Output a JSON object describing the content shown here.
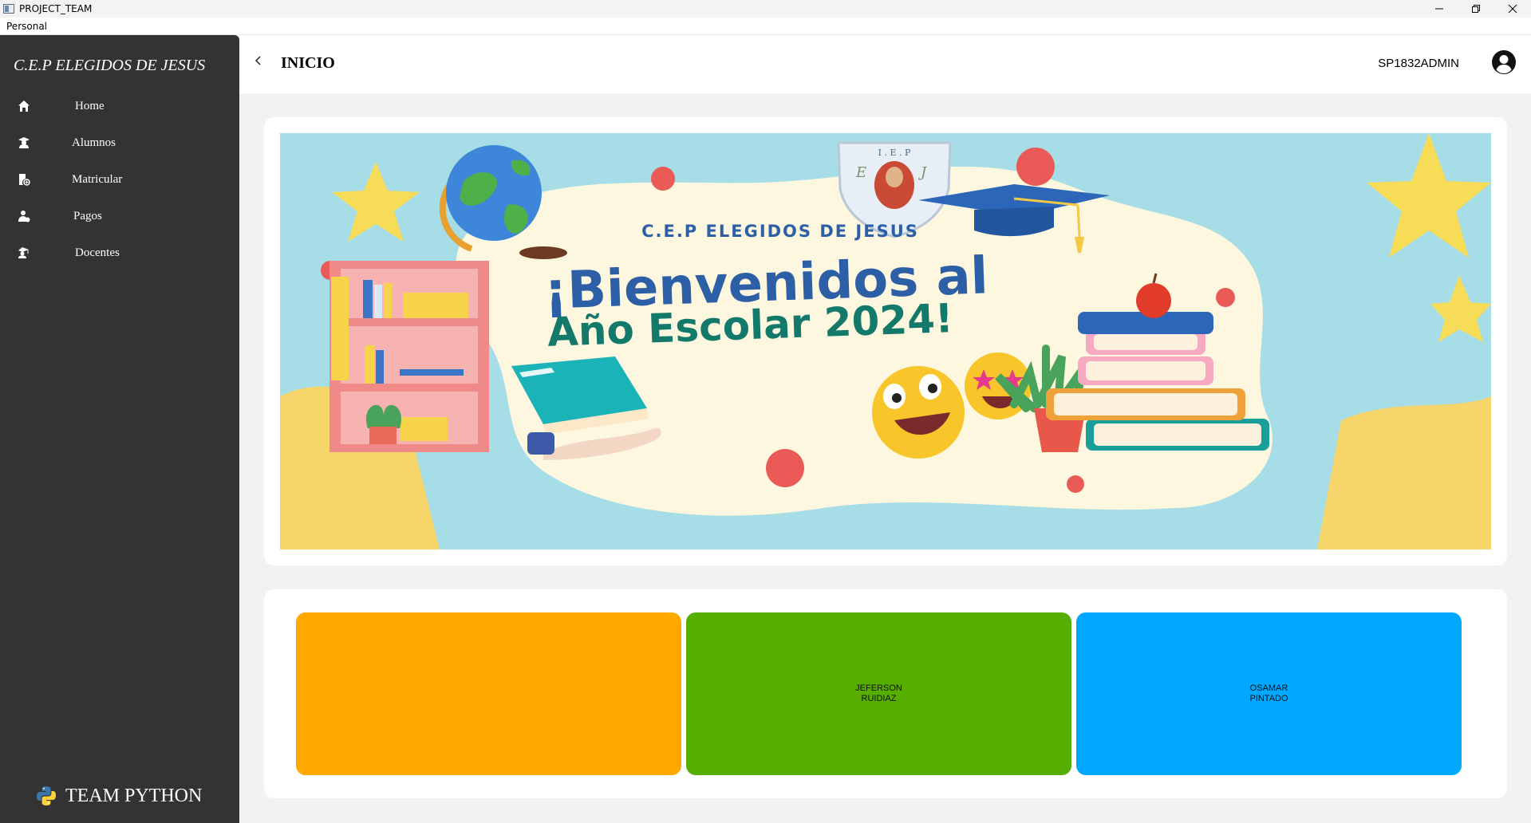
{
  "window": {
    "title": "PROJECT_TEAM",
    "menu": [
      "Personal"
    ]
  },
  "sidebar": {
    "brand": "C.E.P ELEGIDOS DE JESUS",
    "items": [
      {
        "label": "Home",
        "icon": "home-icon"
      },
      {
        "label": "Alumnos",
        "icon": "student-icon"
      },
      {
        "label": "Matricular",
        "icon": "enroll-icon"
      },
      {
        "label": "Pagos",
        "icon": "payments-icon"
      },
      {
        "label": "Docentes",
        "icon": "teacher-icon"
      }
    ],
    "footer": "TEAM PYTHON"
  },
  "header": {
    "title": "INICIO",
    "user": "SP1832ADMIN"
  },
  "banner": {
    "school": "C.E.P ELEGIDOS DE JESUS",
    "line1": "¡Bienvenidos al",
    "line2": "Año Escolar 2024!",
    "crest_text": "I . E . P",
    "crest_initials": [
      "E",
      "J"
    ]
  },
  "tiles": [
    {
      "line1": "",
      "line2": "",
      "color": "#ffa800"
    },
    {
      "line1": "JEFERSON",
      "line2": "RUIDIAZ",
      "color": "#56ae00"
    },
    {
      "line1": "OSAMAR",
      "line2": "PINTADO",
      "color": "#00a8ff"
    }
  ],
  "colors": {
    "sidebar": "#333333",
    "main_bg": "#f2f2f2",
    "banner_title": "#2c5fa6",
    "banner_subtitle": "#137a6b"
  }
}
